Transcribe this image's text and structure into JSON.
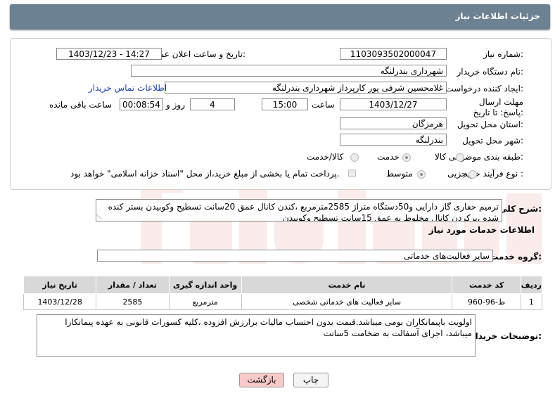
{
  "header": {
    "title": "جزئیات اطلاعات نیاز"
  },
  "fields": {
    "need_number_label": "شماره نیاز:",
    "need_number": "1103093502000047",
    "announce_label": "تاریخ و ساعت اعلان عمومی:",
    "announce_value": "1403/12/23 - 14:27",
    "buyer_label": "نام دستگاه خریدار:",
    "buyer_value": "شهرداری بندرلنگه",
    "creator_label": "ایجاد کننده درخواست:",
    "creator_value": "غلامحسین شرفی پور کارپرداز شهرداری بندرلنگه",
    "contact_link": "اطلاعات تماس خریدار",
    "deadline_label": "مهلت ارسال پاسخ: تا تاریخ:",
    "deadline_date": "1403/12/27",
    "time_label": "ساعت",
    "deadline_time": "15:00",
    "days_value": "4",
    "days_label": "روز و",
    "remaining_value": "00:08:54",
    "remaining_label": "ساعت باقی مانده",
    "province_label": "استان محل تحویل:",
    "province_value": "هرمزگان",
    "city_label": "شهر محل تحویل:",
    "city_value": "بندرلنگه",
    "category_label": "طبقه بندی موضوعی:",
    "category_options": [
      "کالا",
      "خدمت",
      "کالا/خدمت"
    ],
    "process_label": "نوع فرآیند خرید :",
    "process_options": [
      "جزیی",
      "متوسط"
    ],
    "payment_note": "پرداخت تمام یا بخشی از مبلغ خرید،از محل \"اسناد خزانه اسلامی\" خواهد بود."
  },
  "summary": {
    "label": "شرح کلی نیاز:",
    "text": "ترمیم حفاری گاز دارایی و50دستگاه متراژ 2585مترمربع ،کندن کانال عمق 20سانت تسطیح وکوبیدن بستر کنده شده ،پرکردن کانال مخلوط به عمق 15سانت تسطیح وکوبیدن"
  },
  "services": {
    "section_title": "اطلاعات خدمات مورد نیاز",
    "group_label": "گروه خدمت:",
    "group_value": "سایر فعالیت‌های خدماتی",
    "columns": [
      "ردیف",
      "کد خدمت",
      "نام خدمت",
      "واحد اندازه گیری",
      "تعداد / مقدار",
      "تاریخ نیاز"
    ],
    "rows": [
      [
        "1",
        "ط-96-960",
        "سایر فعالیت های خدماتی شخصی",
        "مترمربع",
        "2585",
        "1403/12/28"
      ]
    ]
  },
  "buyer_notes": {
    "label": "توضیحات خریدار:",
    "text": "اولویت باپیمانکاران بومی میباشد.قیمت بدون احتساب مالیات برارزش افزوده ،کلیه کسورات قانونی به عهده پیمانکارا میباشد، اجرای آسفالت به ضخامت 5سانت"
  },
  "buttons": {
    "print": "چاپ",
    "back": "بازگشت"
  },
  "colors": {
    "titlebar": "#6c8192",
    "table_header": "#d8d8d8",
    "link": "#1a3fb5",
    "back_button": "#f7caca"
  }
}
